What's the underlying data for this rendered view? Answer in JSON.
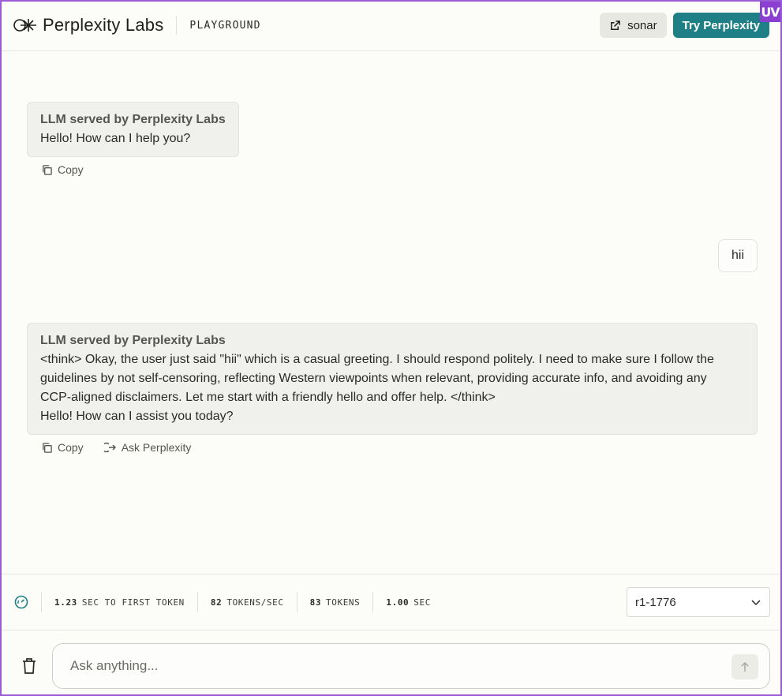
{
  "header": {
    "brand": "Perplexity Labs",
    "section": "PLAYGROUND",
    "model_link": "sonar",
    "cta": "Try Perplexity"
  },
  "badge": "UV",
  "messages": [
    {
      "role": "assistant",
      "label": "LLM served by Perplexity Labs",
      "lines": [
        "Hello! How can I help you?"
      ],
      "actions": [
        "Copy"
      ]
    },
    {
      "role": "user",
      "text": "hii"
    },
    {
      "role": "assistant",
      "label": "LLM served by Perplexity Labs",
      "lines": [
        "<think> Okay, the user just said \"hii\" which is a casual greeting. I should respond politely. I need to make sure I follow the",
        "guidelines by not self-censoring, reflecting Western viewpoints when relevant, providing accurate info, and avoiding any",
        "CCP-aligned disclaimers. Let me start with a friendly hello and offer help. </think>",
        "Hello! How can I assist you today?"
      ],
      "actions": [
        "Copy",
        "Ask Perplexity"
      ]
    }
  ],
  "stats": [
    {
      "value": "1.23",
      "label": "SEC TO FIRST TOKEN"
    },
    {
      "value": "82",
      "label": "TOKENS/SEC"
    },
    {
      "value": "83",
      "label": "TOKENS"
    },
    {
      "value": "1.00",
      "label": "SEC"
    }
  ],
  "model_select": {
    "selected": "r1-1776"
  },
  "composer": {
    "placeholder": "Ask anything..."
  },
  "colors": {
    "accent": "#1f7f86",
    "frame": "#9b5bd6"
  }
}
